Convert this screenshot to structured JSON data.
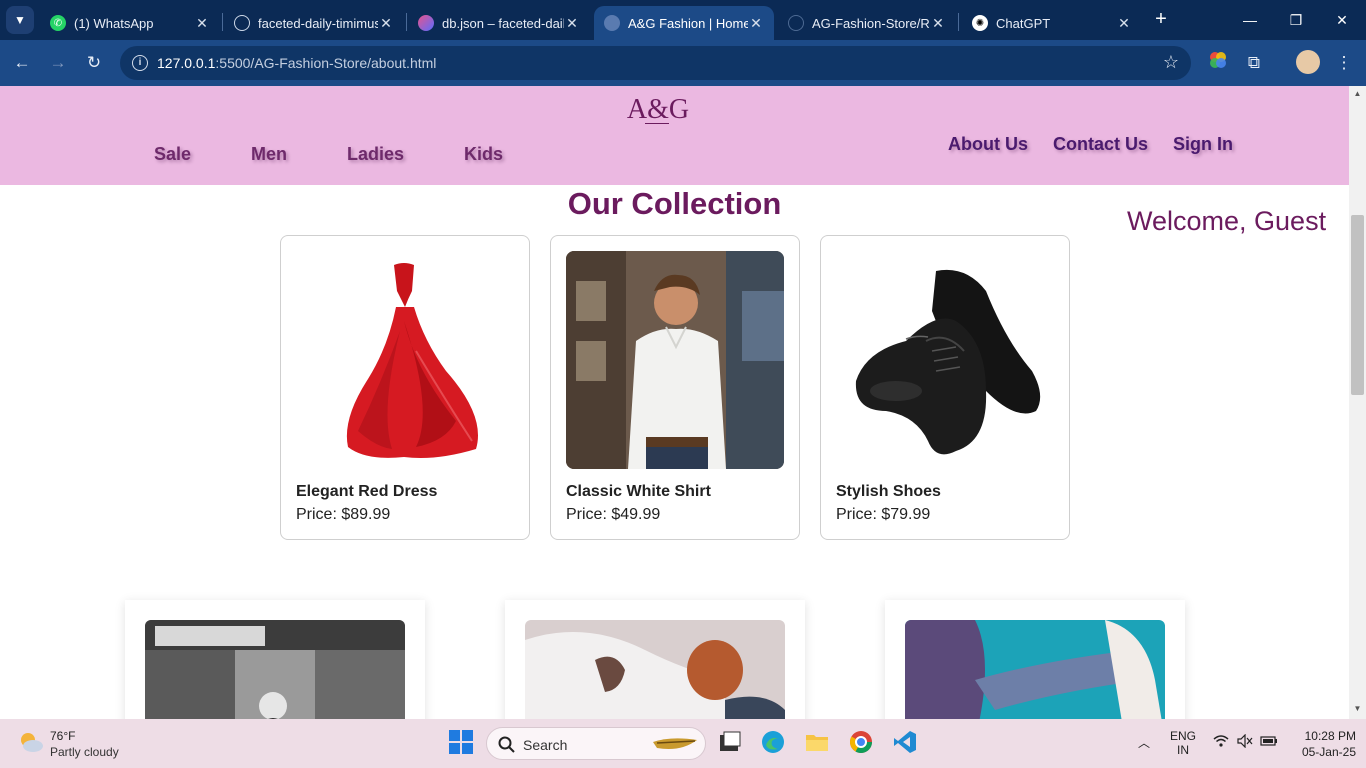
{
  "browser": {
    "tabs": [
      {
        "title": "(1) WhatsApp",
        "icon": "whatsapp-icon",
        "active": false
      },
      {
        "title": "faceted-daily-timimus",
        "icon": "github-icon",
        "active": false
      },
      {
        "title": "db.json – faceted-daily",
        "icon": "glitch-icon",
        "active": false
      },
      {
        "title": "A&G Fashion | Home",
        "icon": "globe-icon",
        "active": true
      },
      {
        "title": "AG-Fashion-Store/RE",
        "icon": "github-icon",
        "active": false
      },
      {
        "title": "ChatGPT",
        "icon": "openai-icon",
        "active": false
      }
    ],
    "url_host": "127.0.0.1",
    "url_path": ":5500/AG-Fashion-Store/about.html"
  },
  "site": {
    "logo": "A&G",
    "nav_left": [
      "Sale",
      "Men",
      "Ladies",
      "Kids"
    ],
    "nav_right": [
      "About Us",
      "Contact Us",
      "Sign In"
    ],
    "collection_title": "Our Collection",
    "welcome": "Welcome, Guest",
    "products": [
      {
        "name": "Elegant Red Dress",
        "price": "Price: $89.99",
        "image": "red-dress"
      },
      {
        "name": "Classic White Shirt",
        "price": "Price: $49.99",
        "image": "white-shirt-man"
      },
      {
        "name": "Stylish Shoes",
        "price": "Price: $79.99",
        "image": "black-shoes"
      }
    ],
    "story_images": [
      "vintage-store-photo",
      "clothing-photo",
      "hug-photo"
    ]
  },
  "taskbar": {
    "weather_temp": "76°F",
    "weather_desc": "Partly cloudy",
    "search_label": "Search",
    "lang_top": "ENG",
    "lang_bottom": "IN",
    "time": "10:28 PM",
    "date": "05-Jan-25"
  },
  "colors": {
    "brand": "#6b1b5e",
    "header_bg": "#ebb8e1",
    "chrome_dark": "#0b2a55",
    "chrome_toolbar": "#1c4a87"
  }
}
